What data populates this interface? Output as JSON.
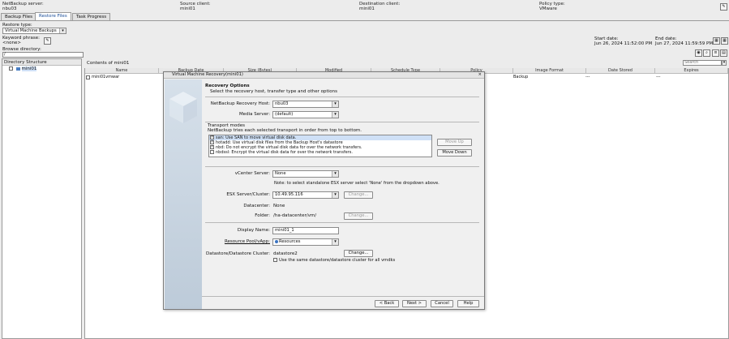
{
  "header": {
    "server_label": "NetBackup server:",
    "server_value": "nbu03",
    "source_label": "Source client:",
    "source_value": "mini01",
    "dest_label": "Destination client:",
    "dest_value": "mini01",
    "policy_label": "Policy type:",
    "policy_value": "VMware"
  },
  "tabs": [
    "Backup Files",
    "Restore Files",
    "Task Progress"
  ],
  "restore_type": {
    "label": "Restore type:",
    "value": "Virtual Machine Backups"
  },
  "keyword": {
    "label": "Keyword phrase:",
    "value": "<none>"
  },
  "browse": {
    "label": "Browse directory:",
    "value": "/"
  },
  "dates": {
    "start_label": "Start date:",
    "start_value": "Jun 26, 2024 11:52:00 PM",
    "end_label": "End date:",
    "end_value": "Jun 27, 2024 11:59:59 PM"
  },
  "tree": {
    "header": "Directory Structure",
    "item": "mini01"
  },
  "contents": {
    "title": "Contents of mini01",
    "search_placeholder": "Search",
    "columns": [
      "Name",
      "Backup Date",
      "Size (Bytes)",
      "Modified",
      "Schedule Type",
      "Policy",
      "Image Format",
      "Date Stored",
      "Expires"
    ],
    "row": {
      "name": "mini01vmwar",
      "policy": "Backup",
      "stored": "---",
      "expires": "---"
    }
  },
  "dialog": {
    "title": "Virtual Machine Recovery(mini01)",
    "section_title": "Recovery Options",
    "section_subtitle": "Select the recovery host, transfer type and other options",
    "recovery_host_label": "NetBackup Recovery Host:",
    "recovery_host_value": "nbu03",
    "media_server_label": "Media Server:",
    "media_server_value": "(default)",
    "transport_title": "Transport modes",
    "transport_subtitle": "NetBackup tries each selected transport in order from top to bottom.",
    "transport_items": [
      "san: Use SAN to move virtual disk data.",
      "hotadd: Use virtual disk files from the Backup Host's datastore",
      "nbd: Do not encrypt the virtual disk data for over the network transfers.",
      "nbdssl: Encrypt the virtual disk data for over the network transfers."
    ],
    "move_up": "Move Up",
    "move_down": "Move Down",
    "vcenter_label": "vCenter Server:",
    "vcenter_value": "None",
    "vcenter_note": "Note: to select standalone ESX server select 'None' from the dropdown above.",
    "esx_label": "ESX Server/Cluster:",
    "esx_value": "10.49.95.116",
    "change": "Change...",
    "datacenter_label": "Datacenter:",
    "datacenter_value": "None",
    "folder_label": "Folder:",
    "folder_value": "/ha-datacenter/vm/",
    "display_name_label": "Display Name:",
    "display_name_value": "mini01_1",
    "pool_label": "Resource Pool/vApp:",
    "pool_value": "Resources",
    "datastore_label": "Datastore/Datastore Cluster:",
    "datastore_value": "datastore2",
    "same_datastore": "Use the same datastore/datastore cluster for all vmdks",
    "back": "< Back",
    "next": "Next >",
    "cancel": "Cancel",
    "help": "Help"
  }
}
